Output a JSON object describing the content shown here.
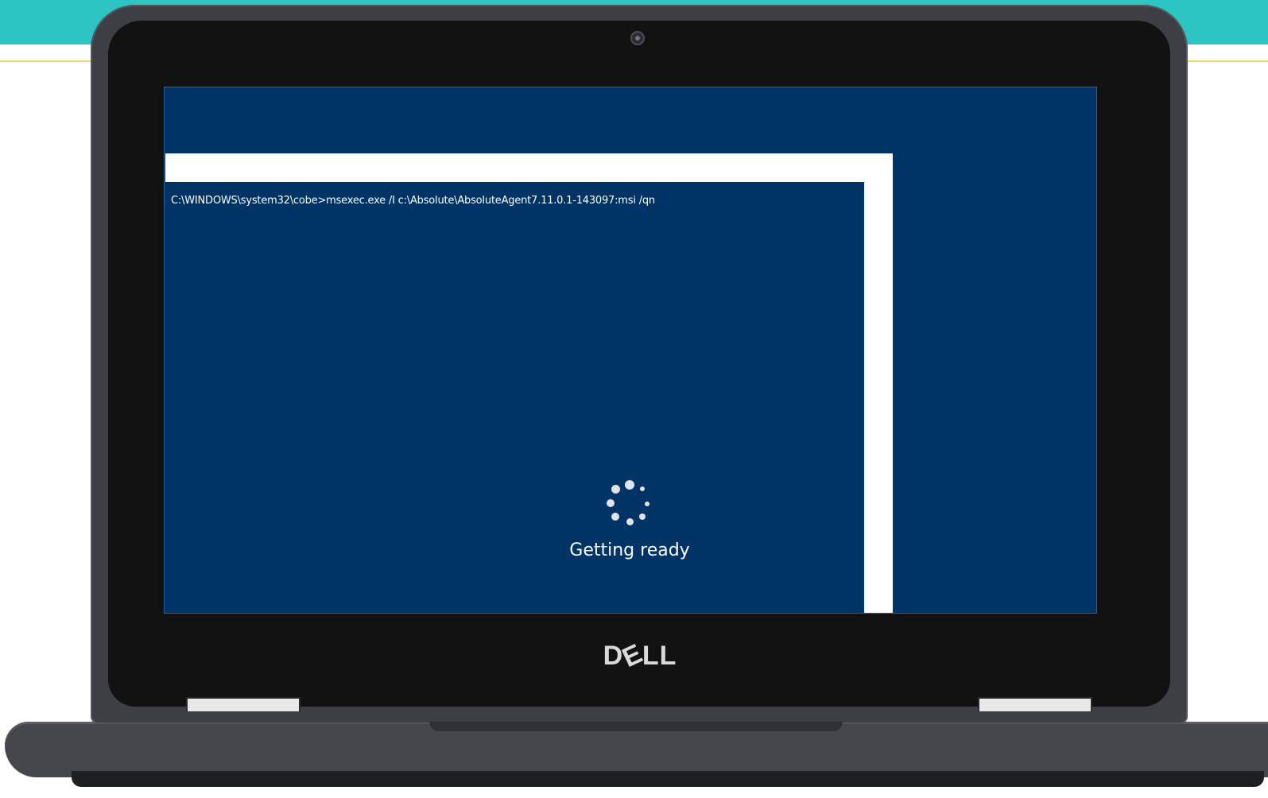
{
  "command_prompt": {
    "text": "C:\\WINDOWS\\system32\\cobe>msexec.exe /I c:\\Absolute\\AbsoluteAgent7.11.0.1-143097:msi /qn"
  },
  "status": {
    "text": "Getting ready",
    "icon": "loading-spinner-icon"
  },
  "brand": {
    "logo_text": "DELL",
    "logo_name": "dell-logo"
  },
  "colors": {
    "screen_background": "#003366",
    "top_band": "#2ec4c4",
    "laptop_body": "#3d3f44"
  }
}
